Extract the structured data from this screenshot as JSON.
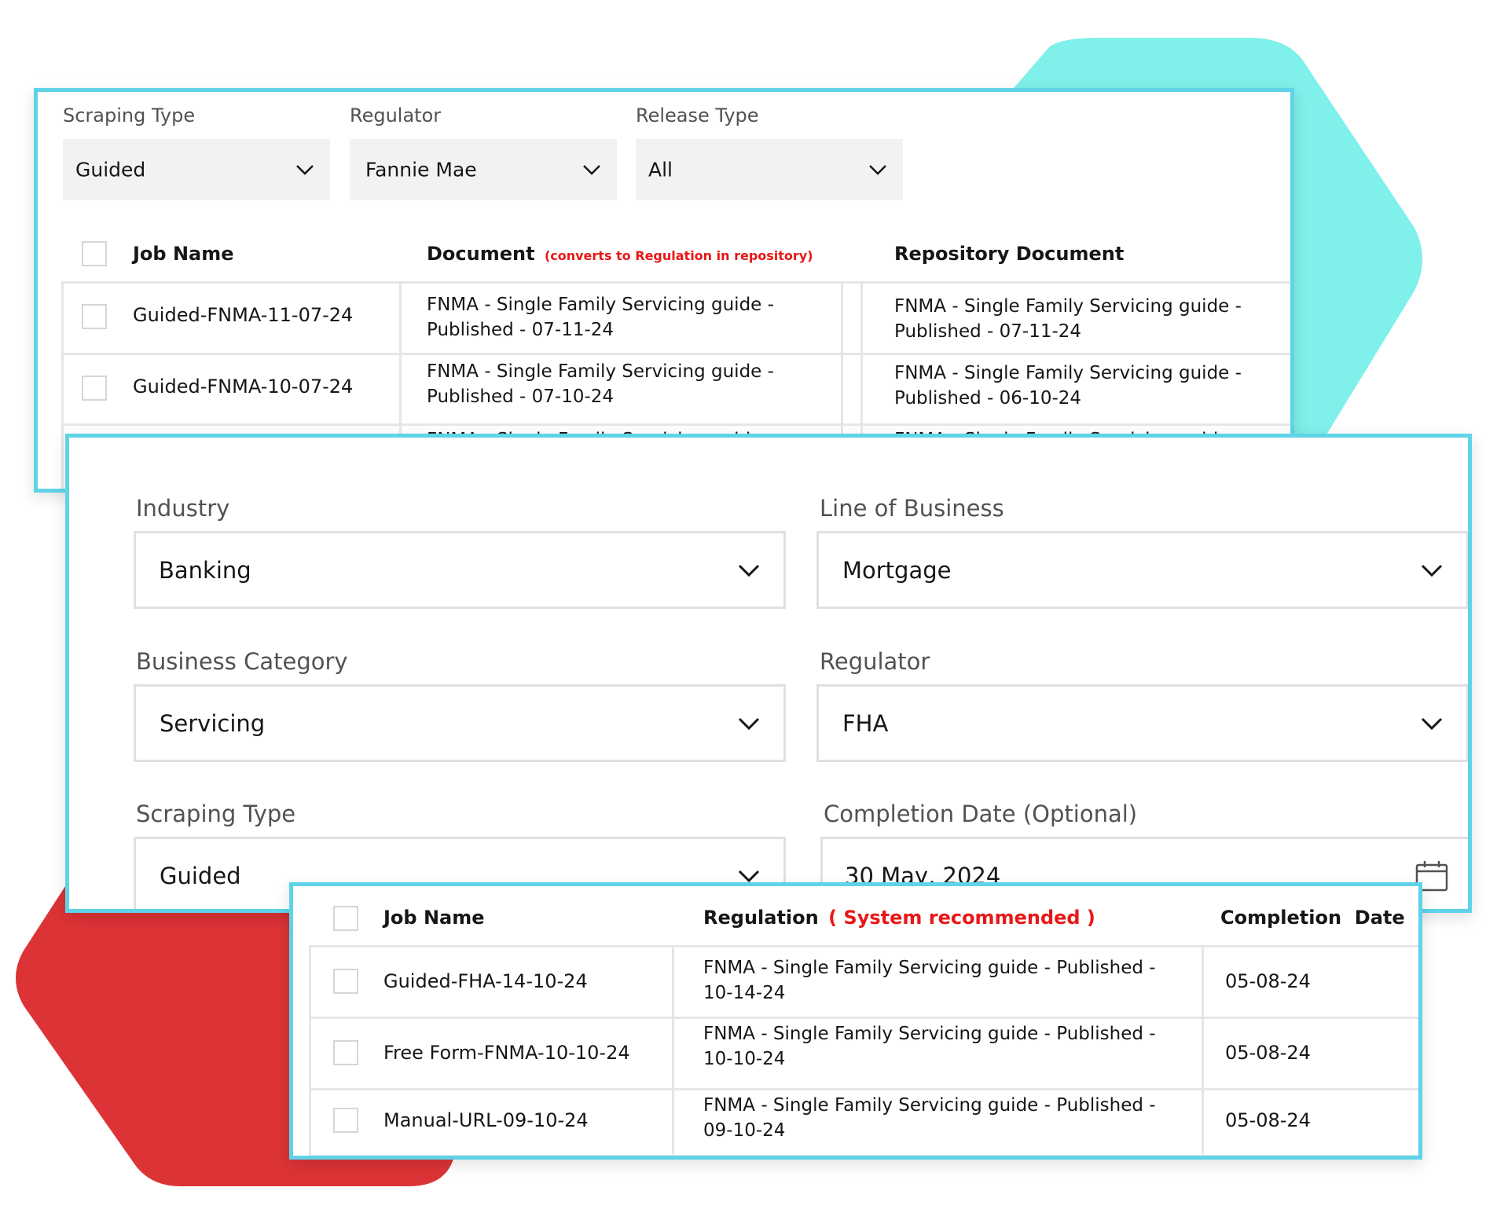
{
  "colors": {
    "teal": "#7ff0ea",
    "red": "#dc3336",
    "border": "#5fd3e8",
    "alert": "#e81717"
  },
  "panel1": {
    "filters": [
      {
        "label": "Scraping Type",
        "value": "Guided"
      },
      {
        "label": "Regulator",
        "value": "Fannie Mae"
      },
      {
        "label": "Release Type",
        "value": "All"
      }
    ],
    "headers": {
      "job_name": "Job Name",
      "document": "Document",
      "document_note": "(converts to Regulation in repository)",
      "repository": "Repository Document"
    },
    "rows": [
      {
        "job": "Guided-FNMA-11-07-24",
        "doc": [
          "FNMA - Single Family Servicing guide -",
          "Published - 07-11-24"
        ],
        "repo": [
          "FNMA - Single Family Servicing guide -",
          "Published - 07-11-24"
        ]
      },
      {
        "job": "Guided-FNMA-10-07-24",
        "doc": [
          "FNMA - Single Family Servicing guide -",
          "Published - 07-10-24"
        ],
        "repo": [
          "FNMA - Single Family Servicing guide -",
          "Published - 06-10-24"
        ]
      }
    ],
    "partial_row": {
      "doc": "FNMA - Single Family Servicing guide -",
      "repo": "FNMA - Single Family Servicing guide -"
    }
  },
  "panel2": {
    "industry": {
      "label": "Industry",
      "value": "Banking"
    },
    "line_of_business": {
      "label": "Line of Business",
      "value": "Mortgage"
    },
    "business_category": {
      "label": "Business Category",
      "value": "Servicing"
    },
    "regulator": {
      "label": "Regulator",
      "value": "FHA"
    },
    "scraping_type": {
      "label": "Scraping Type",
      "value": "Guided"
    },
    "completion_date": {
      "label": "Completion Date (Optional)",
      "value": "30 May, 2024",
      "icon": "calendar-icon"
    }
  },
  "panel3": {
    "headers": {
      "job_name": "Job Name",
      "regulation": "Regulation",
      "regulation_note": "( System recommended )",
      "completion": "Completion  Date"
    },
    "rows": [
      {
        "job": "Guided-FHA-14-10-24",
        "reg": [
          "FNMA - Single Family Servicing guide - Published -",
          "10-14-24"
        ],
        "date": "05-08-24"
      },
      {
        "job": "Free Form-FNMA-10-10-24",
        "reg": [
          "FNMA - Single Family Servicing guide - Published -",
          "10-10-24"
        ],
        "date": "05-08-24"
      },
      {
        "job": "Manual-URL-09-10-24",
        "reg": [
          "FNMA - Single Family Servicing guide - Published -",
          "09-10-24"
        ],
        "date": "05-08-24"
      }
    ]
  }
}
